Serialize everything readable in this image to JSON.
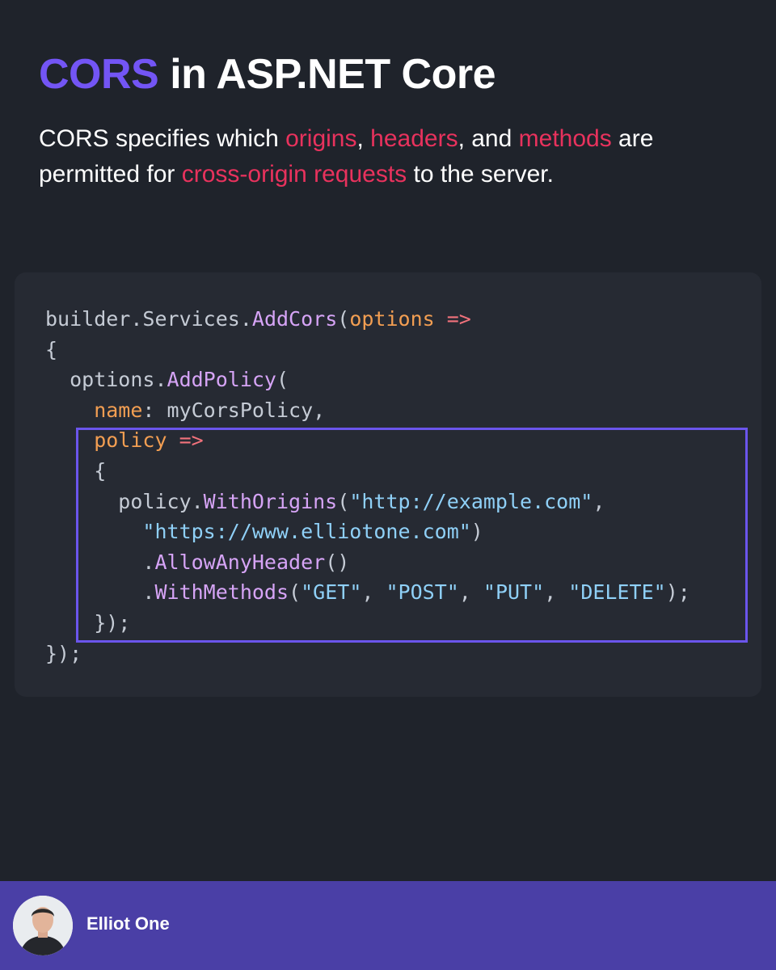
{
  "title": {
    "accent": "CORS",
    "rest": " in ASP.NET Core"
  },
  "subtitle": {
    "t1": "CORS specifies which ",
    "h1": "origins",
    "t2": ", ",
    "h2": "headers",
    "t3": ", and ",
    "h3": "methods",
    "t4": " are permitted for ",
    "h4": "cross-origin requests",
    "t5": " to the server."
  },
  "code_lines": [
    [
      [
        "p",
        "builder."
      ],
      [
        "p",
        "Services."
      ],
      [
        "m",
        "AddCors"
      ],
      [
        "p",
        "("
      ],
      [
        "o",
        "options"
      ],
      [
        "p",
        " "
      ],
      [
        "a",
        "=>"
      ]
    ],
    [
      [
        "p",
        "{"
      ]
    ],
    [
      [
        "p",
        "  options."
      ],
      [
        "m",
        "AddPolicy"
      ],
      [
        "p",
        "("
      ]
    ],
    [
      [
        "o",
        "    name"
      ],
      [
        "p",
        ": myCorsPolicy,"
      ]
    ],
    [
      [
        "o",
        "    policy"
      ],
      [
        "p",
        " "
      ],
      [
        "a",
        "=>"
      ]
    ],
    [
      [
        "p",
        "    {"
      ]
    ],
    [
      [
        "p",
        "      policy."
      ],
      [
        "m",
        "WithOrigins"
      ],
      [
        "p",
        "("
      ],
      [
        "s",
        "\"http://example.com\""
      ],
      [
        "p",
        ","
      ]
    ],
    [
      [
        "s",
        "        \"https://www.elliotone.com\""
      ],
      [
        "p",
        ")"
      ]
    ],
    [
      [
        "p",
        "        ."
      ],
      [
        "m",
        "AllowAnyHeader"
      ],
      [
        "p",
        "()"
      ]
    ],
    [
      [
        "p",
        "        ."
      ],
      [
        "m",
        "WithMethods"
      ],
      [
        "p",
        "("
      ],
      [
        "s",
        "\"GET\""
      ],
      [
        "p",
        ", "
      ],
      [
        "s",
        "\"POST\""
      ],
      [
        "p",
        ", "
      ],
      [
        "s",
        "\"PUT\""
      ],
      [
        "p",
        ", "
      ],
      [
        "s",
        "\"DELETE\""
      ],
      [
        "p",
        ");"
      ]
    ],
    [
      [
        "p",
        "    });"
      ]
    ],
    [
      [
        "p",
        "});"
      ]
    ]
  ],
  "footer": {
    "author_name": "Elliot One",
    "avatar_icon": "person-avatar"
  },
  "colors": {
    "background": "#1f232b",
    "code_card": "#262a33",
    "accent_purple": "#7355f5",
    "highlight_red": "#e8325d",
    "footer": "#4a3fa6"
  }
}
